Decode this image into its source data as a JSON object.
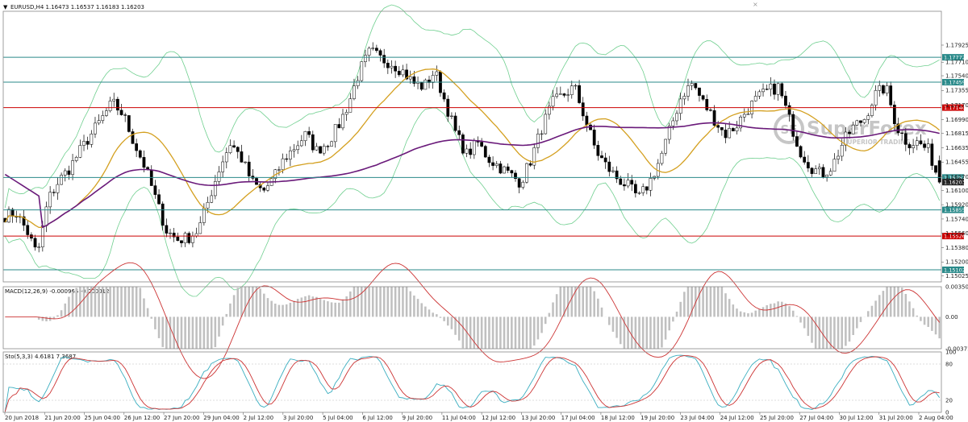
{
  "window": {
    "menu_glyph": "▼",
    "symbol_header": "EURUSD,H4  1.16473 1.16537 1.16183 1.16203",
    "close_glyph": "×"
  },
  "watermark": {
    "brand": "SuperForex",
    "tagline": "SUPERIOR TRADING",
    "logo_letters": "SF",
    "color": "#b8b8b8"
  },
  "chart_data": [
    {
      "type": "candlestick",
      "panel": "price",
      "title": "EURUSD,H4",
      "ohlc_header": {
        "open": 1.16473,
        "high": 1.16537,
        "low": 1.16183,
        "close": 1.16203
      },
      "ylim": [
        1.1495,
        1.1835
      ],
      "y_ticks": [
        "1.17925",
        "1.17710",
        "1.17540",
        "1.17355",
        "1.17170",
        "1.16990",
        "1.16815",
        "1.16635",
        "1.16455",
        "1.16270",
        "1.16100",
        "1.15920",
        "1.15740",
        "1.15560",
        "1.15380",
        "1.15200",
        "1.15025"
      ],
      "x_ticks": [
        "20 Jun 2018",
        "21 Jun 20:00",
        "25 Jun 04:00",
        "26 Jun 12:00",
        "27 Jun 20:00",
        "29 Jun 04:00",
        "2 Jul 12:00",
        "3 Jul 20:00",
        "5 Jul 04:00",
        "6 Jul 12:00",
        "9 Jul 20:00",
        "11 Jul 04:00",
        "12 Jul 12:00",
        "13 Jul 20:00",
        "17 Jul 04:00",
        "18 Jul 12:00",
        "19 Jul 20:00",
        "23 Jul 04:00",
        "24 Jul 12:00",
        "25 Jul 20:00",
        "27 Jul 04:00",
        "30 Jul 12:00",
        "31 Jul 20:00",
        "2 Aug 04:00"
      ],
      "close_path": [
        1.1578,
        1.1582,
        1.156,
        1.1528,
        1.1598,
        1.1622,
        1.1638,
        1.166,
        1.168,
        1.17,
        1.172,
        1.1705,
        1.167,
        1.164,
        1.16,
        1.156,
        1.1548,
        1.155,
        1.156,
        1.16,
        1.164,
        1.167,
        1.165,
        1.162,
        1.1608,
        1.1625,
        1.165,
        1.1665,
        1.168,
        1.166,
        1.167,
        1.169,
        1.172,
        1.176,
        1.1785,
        1.1775,
        1.177,
        1.176,
        1.1745,
        1.174,
        1.176,
        1.172,
        1.168,
        1.1655,
        1.167,
        1.165,
        1.164,
        1.163,
        1.162,
        1.165,
        1.169,
        1.172,
        1.173,
        1.174,
        1.17,
        1.166,
        1.164,
        1.1625,
        1.1615,
        1.16,
        1.162,
        1.165,
        1.169,
        1.173,
        1.1745,
        1.172,
        1.17,
        1.168,
        1.169,
        1.171,
        1.1725,
        1.1735,
        1.174,
        1.17,
        1.166,
        1.164,
        1.163,
        1.164,
        1.167,
        1.169,
        1.17,
        1.173,
        1.174,
        1.169,
        1.167,
        1.167,
        1.166,
        1.162
      ],
      "horizontal_levels": [
        {
          "label": "1.17772",
          "value": 1.17772,
          "color": "#2a8a8a"
        },
        {
          "label": "1.17459",
          "value": 1.17459,
          "color": "#2a8a8a"
        },
        {
          "label": "1.17140",
          "value": 1.1714,
          "color": "#cc0000"
        },
        {
          "label": "1.16262",
          "value": 1.16262,
          "color": "#2a8a8a"
        },
        {
          "label": "1.16203",
          "value": 1.16203,
          "color": "#222222"
        },
        {
          "label": "1.15855",
          "value": 1.15855,
          "color": "#2a8a8a"
        },
        {
          "label": "1.15526",
          "value": 1.15526,
          "color": "#cc0000"
        },
        {
          "label": "1.15102",
          "value": 1.15102,
          "color": "#2a8a8a"
        }
      ],
      "colors": {
        "bull_candle": "#ffffff",
        "bear_candle": "#000000",
        "wick": "#000000",
        "ma_fast": "#d4a020",
        "ma_slow": "#6a1a7a",
        "bollinger": "#6fcf8f"
      }
    },
    {
      "type": "histogram",
      "panel": "macd",
      "title": "MACD(12,26,9) -0.000965 -0.000012",
      "ylim": [
        -0.003715,
        0.003505
      ],
      "y_ticks": [
        "0.003505",
        "0.00",
        "-0.003715"
      ],
      "colors": {
        "histogram": "#c0c0c0",
        "signal": "#cc3333"
      }
    },
    {
      "type": "line",
      "panel": "stochastic",
      "title": "Sto(5,3,3) 4.6181 7.3687",
      "ylim": [
        0,
        100
      ],
      "y_ticks": [
        "100",
        "80",
        "20",
        "0"
      ],
      "levels": [
        80,
        20
      ],
      "colors": {
        "main": "#3aaec0",
        "signal": "#cc3333"
      }
    }
  ]
}
